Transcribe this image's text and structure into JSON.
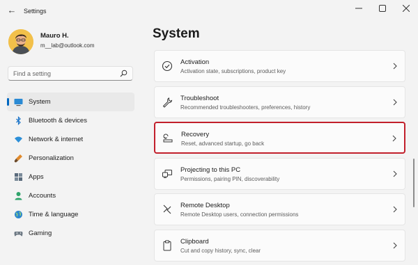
{
  "app": {
    "title": "Settings"
  },
  "user": {
    "name": "Mauro H.",
    "email": "m__lab@outlook.com"
  },
  "search": {
    "placeholder": "Find a setting"
  },
  "nav": [
    {
      "label": "System",
      "icon": "system-icon",
      "active": true
    },
    {
      "label": "Bluetooth & devices",
      "icon": "bluetooth-icon"
    },
    {
      "label": "Network & internet",
      "icon": "wifi-icon"
    },
    {
      "label": "Personalization",
      "icon": "brush-icon"
    },
    {
      "label": "Apps",
      "icon": "apps-icon"
    },
    {
      "label": "Accounts",
      "icon": "accounts-icon"
    },
    {
      "label": "Time & language",
      "icon": "globe-icon"
    },
    {
      "label": "Gaming",
      "icon": "gaming-icon"
    }
  ],
  "main": {
    "title": "System",
    "cards": [
      {
        "title": "Activation",
        "subtitle": "Activation state, subscriptions, product key",
        "icon": "check-circle-icon"
      },
      {
        "title": "Troubleshoot",
        "subtitle": "Recommended troubleshooters, preferences, history",
        "icon": "wrench-icon"
      },
      {
        "title": "Recovery",
        "subtitle": "Reset, advanced startup, go back",
        "icon": "recovery-icon",
        "highlighted": true
      },
      {
        "title": "Projecting to this PC",
        "subtitle": "Permissions, pairing PIN, discoverability",
        "icon": "projecting-icon"
      },
      {
        "title": "Remote Desktop",
        "subtitle": "Remote Desktop users, connection permissions",
        "icon": "remote-desktop-icon"
      },
      {
        "title": "Clipboard",
        "subtitle": "Cut and copy history, sync, clear",
        "icon": "clipboard-icon"
      }
    ]
  },
  "colors": {
    "accent": "#0067c0",
    "highlight_border": "#c21f2b",
    "background": "#f3f3f3",
    "card": "#fbfbfb"
  }
}
